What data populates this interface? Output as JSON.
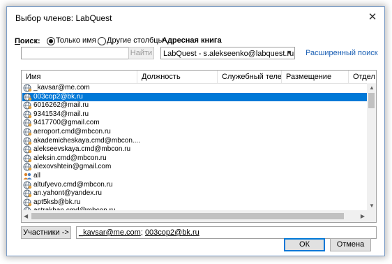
{
  "window": {
    "title": "Выбор членов: LabQuest",
    "close_icon": "close-icon"
  },
  "search": {
    "label": "Поиск:",
    "radio_name_only": "Только имя",
    "radio_other_columns": "Другие столбцы",
    "selected_mode": "Только имя",
    "input_value": "",
    "go_button": "Найти"
  },
  "address_book": {
    "label": "Адресная книга",
    "selected": "LabQuest - s.alekseenko@labquest.ru",
    "advanced_search": "Расширенный поиск"
  },
  "table": {
    "columns": [
      "Имя",
      "Должность",
      "Служебный телеф...",
      "Размещение",
      "Отдел"
    ],
    "rows": [
      {
        "name": "_kavsar@me.com",
        "icon": "contact-globe-icon",
        "selected": false
      },
      {
        "name": "003cop2@bk.ru",
        "icon": "contact-globe-icon",
        "selected": true
      },
      {
        "name": "6016262@mail.ru",
        "icon": "contact-globe-icon",
        "selected": false
      },
      {
        "name": "9341534@mail.ru",
        "icon": "contact-globe-icon",
        "selected": false
      },
      {
        "name": "9417700@gmail.com",
        "icon": "contact-globe-icon",
        "selected": false
      },
      {
        "name": "aeroport.cmd@mbcon.ru",
        "icon": "contact-globe-icon",
        "selected": false
      },
      {
        "name": "akademicheskaya.cmd@mbcon....",
        "icon": "contact-globe-icon",
        "selected": false
      },
      {
        "name": "alekseevskaya.cmd@mbcon.ru",
        "icon": "contact-globe-icon",
        "selected": false
      },
      {
        "name": "aleksin.cmd@mbcon.ru",
        "icon": "contact-globe-icon",
        "selected": false
      },
      {
        "name": "alexovshtein@gmail.com",
        "icon": "contact-globe-icon",
        "selected": false
      },
      {
        "name": "all",
        "icon": "group-icon",
        "selected": false
      },
      {
        "name": "altufyevo.cmd@mbcon.ru",
        "icon": "contact-globe-icon",
        "selected": false
      },
      {
        "name": "an.yahont@yandex.ru",
        "icon": "contact-globe-icon",
        "selected": false
      },
      {
        "name": "apt5ksb@bk.ru",
        "icon": "contact-globe-icon",
        "selected": false
      },
      {
        "name": "astrakhan.cmd@mbcon.ru",
        "icon": "contact-globe-icon",
        "selected": false
      }
    ]
  },
  "members": {
    "button": "Участники ->",
    "value": "_kavsar@me.com; 003cop2@bk.ru",
    "value_parts": [
      "_kavsar@me.com",
      "003cop2@bk.ru"
    ],
    "separator": "; "
  },
  "footer": {
    "ok": "ОК",
    "cancel": "Отмена"
  },
  "colors": {
    "selection": "#0078d7",
    "link": "#1a5fb4",
    "border": "#7a9cc6"
  }
}
